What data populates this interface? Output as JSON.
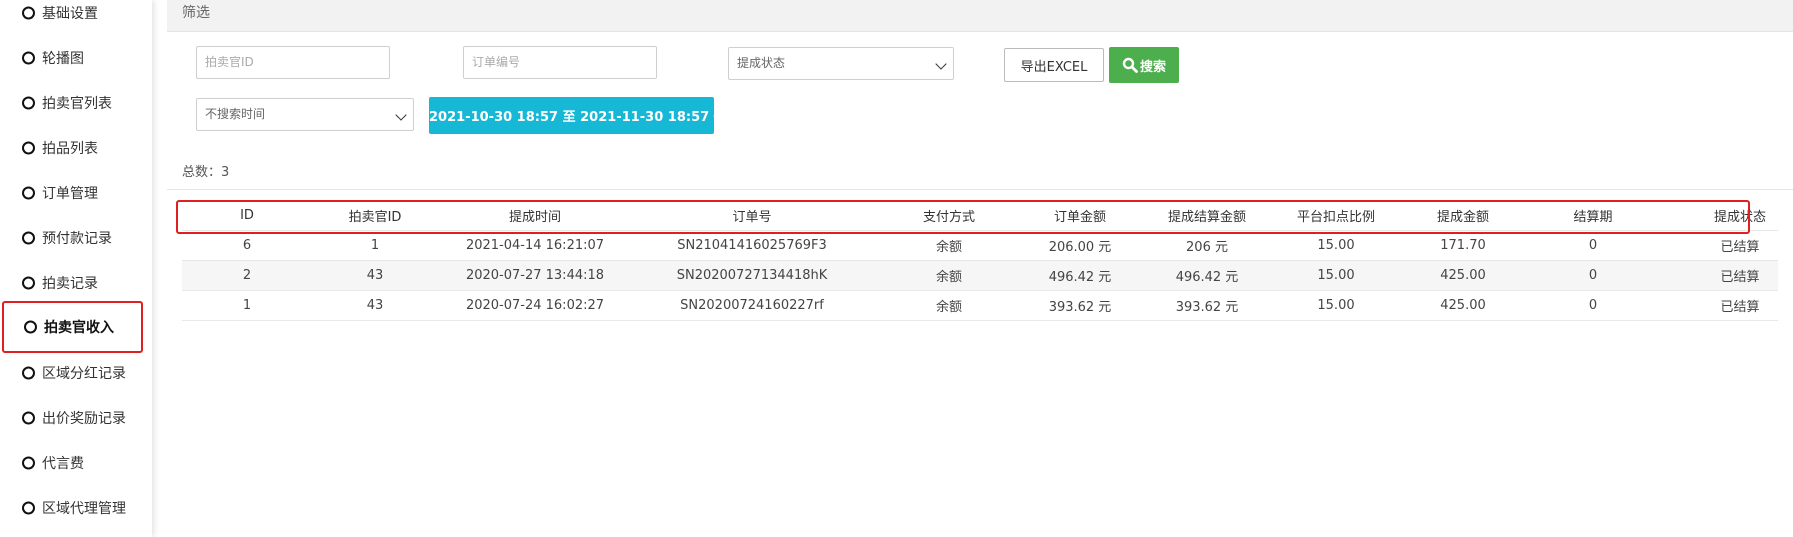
{
  "sidebar": {
    "items": [
      {
        "label": "基础设置"
      },
      {
        "label": "轮播图"
      },
      {
        "label": "拍卖官列表"
      },
      {
        "label": "拍品列表"
      },
      {
        "label": "订单管理"
      },
      {
        "label": "预付款记录"
      },
      {
        "label": "拍卖记录"
      },
      {
        "label": "拍卖官收入",
        "active": true
      },
      {
        "label": "区域分红记录"
      },
      {
        "label": "出价奖励记录"
      },
      {
        "label": "代言费"
      },
      {
        "label": "区域代理管理"
      }
    ]
  },
  "filter": {
    "title": "筛选",
    "auctioneer_id_placeholder": "拍卖官ID",
    "order_no_placeholder": "订单编号",
    "withdraw_status_selected": "提成状态",
    "time_mode_selected": "不搜索时间",
    "export_label": "导出EXCEL",
    "search_label": "搜索",
    "date_range": "2021-10-30 18:57 至 2021-11-30 18:57"
  },
  "summary": {
    "total_label": "总数：3"
  },
  "table": {
    "columns": [
      "ID",
      "拍卖官ID",
      "提成时间",
      "订单号",
      "支付方式",
      "订单金额",
      "提成结算金额",
      "平台扣点比例",
      "提成金额",
      "结算期",
      "提成状态"
    ],
    "rows": [
      [
        "6",
        "1",
        "2021-04-14 16:21:07",
        "SN21041416025769F3",
        "余额",
        "206.00 元",
        "206 元",
        "15.00",
        "171.70",
        "0",
        "已结算"
      ],
      [
        "2",
        "43",
        "2020-07-27 13:44:18",
        "SN20200727134418hK",
        "余额",
        "496.42 元",
        "496.42 元",
        "15.00",
        "425.00",
        "0",
        "已结算"
      ],
      [
        "1",
        "43",
        "2020-07-24 16:02:27",
        "SN20200724160227rf",
        "余额",
        "393.62 元",
        "393.62 元",
        "15.00",
        "425.00",
        "0",
        "已结算"
      ]
    ]
  },
  "colors": {
    "highlight_border": "#e02020",
    "search_button": "#4cae4c",
    "date_button": "#17b8d6"
  },
  "icons": {
    "search": "search-icon",
    "date": "calendar-icon",
    "nav_bullet": "circle-icon"
  }
}
